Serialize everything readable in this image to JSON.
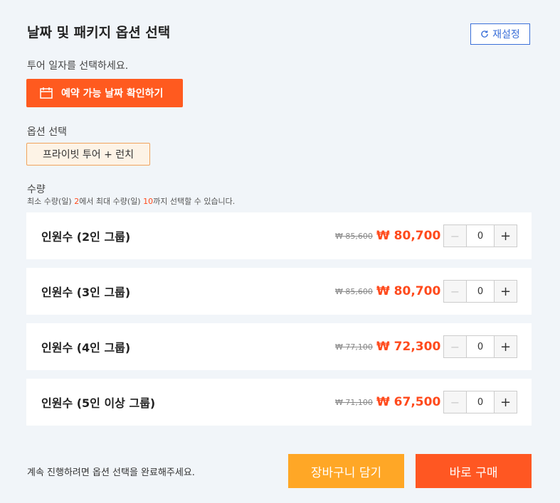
{
  "header": {
    "title": "날짜 및 패키지 옵션 선택",
    "reset_label": "재설정"
  },
  "date_section": {
    "label": "투어 일자를 선택하세요.",
    "button_label": "예약 가능 날짜 확인하기"
  },
  "option_section": {
    "label": "옵션 선택",
    "selected_option": "프라이빗 투어 + 런치"
  },
  "quantity_section": {
    "label": "수량",
    "note_prefix": "최소 수량(일) ",
    "min": "2",
    "note_mid": "에서 최대 수량(일) ",
    "max": "10",
    "note_suffix": "까지 선택할 수 있습니다."
  },
  "items": [
    {
      "name": "인원수 (2인 그룹)",
      "old_price": "₩ 85,600",
      "price": "₩ 80,700",
      "qty": "0"
    },
    {
      "name": "인원수 (3인 그룹)",
      "old_price": "₩ 85,600",
      "price": "₩ 80,700",
      "qty": "0"
    },
    {
      "name": "인원수 (4인 그룹)",
      "old_price": "₩ 77,100",
      "price": "₩ 72,300",
      "qty": "0"
    },
    {
      "name": "인원수 (5인 이상 그룹)",
      "old_price": "₩ 71,100",
      "price": "₩ 67,500",
      "qty": "0"
    }
  ],
  "stepper": {
    "minus": "−",
    "plus": "+"
  },
  "footer": {
    "message": "계속 진행하려면 옵션 선택을 완료해주세요.",
    "cart_label": "장바구니 담기",
    "buy_label": "바로 구매"
  },
  "colors": {
    "accent": "#ff5a1f",
    "price": "#ff4a1c",
    "cart": "#ffa726",
    "link": "#3a6fd8"
  },
  "icons": {
    "reset": "refresh-icon",
    "date": "calendar-icon"
  }
}
